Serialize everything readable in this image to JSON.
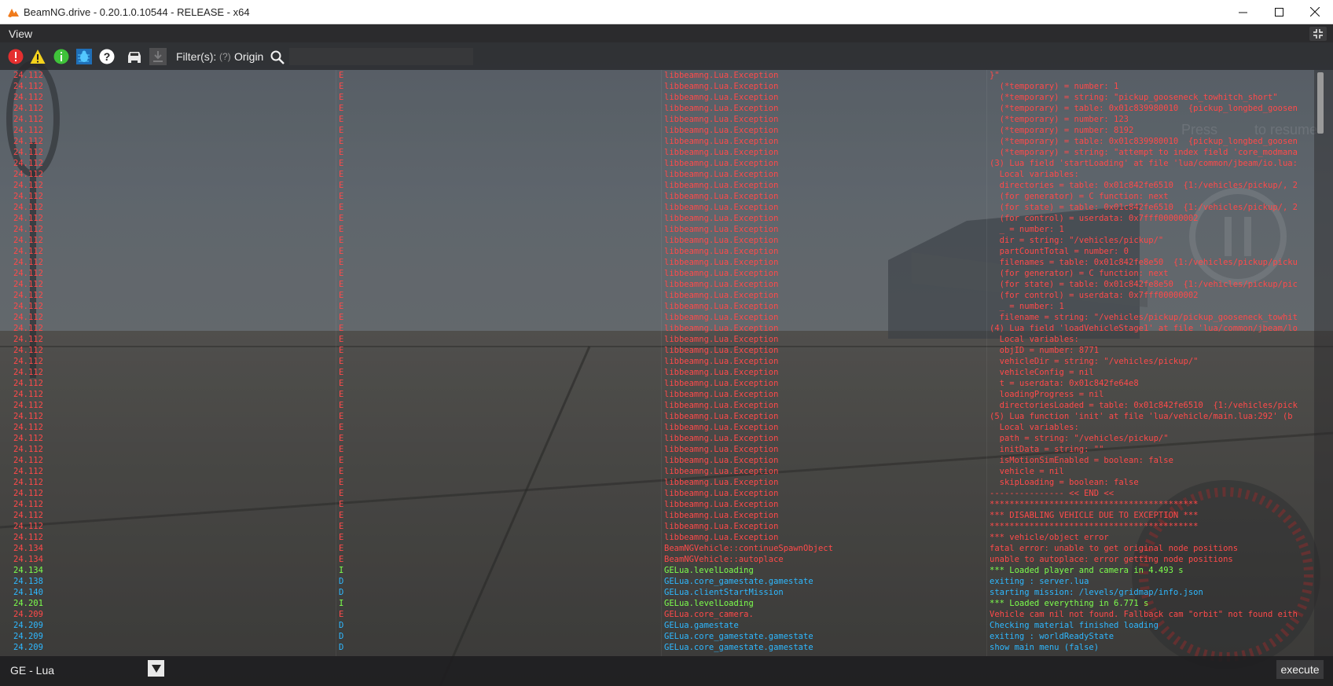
{
  "window": {
    "title": "BeamNG.drive - 0.20.1.0.10544 - RELEASE - x64"
  },
  "menu": {
    "view_label": "View"
  },
  "toolbar": {
    "filter_label": "Filter(s):",
    "filter_hint": "(?)",
    "origin_label": "Origin",
    "search_value": "",
    "icons": [
      "error-icon",
      "warning-icon",
      "info-icon",
      "debug-bug-icon",
      "help-icon",
      "vehicle-icon",
      "download-icon"
    ]
  },
  "colors": {
    "error": "#ff4a4a",
    "info": "#7dff4d",
    "debug": "#2eb8ff"
  },
  "hud": {
    "press_text": "Press",
    "resume_text": "to resume"
  },
  "log": {
    "rows": [
      {
        "time": "24.112",
        "level": "E",
        "origin": "libbeamng.Lua.Exception",
        "message": "}\""
      },
      {
        "time": "24.112",
        "level": "E",
        "origin": "libbeamng.Lua.Exception",
        "message": "  (*temporary) = number: 1"
      },
      {
        "time": "24.112",
        "level": "E",
        "origin": "libbeamng.Lua.Exception",
        "message": "  (*temporary) = string: \"pickup_gooseneck_towhitch_short\""
      },
      {
        "time": "24.112",
        "level": "E",
        "origin": "libbeamng.Lua.Exception",
        "message": "  (*temporary) = table: 0x01c839980010  {pickup_longbed_goosen"
      },
      {
        "time": "24.112",
        "level": "E",
        "origin": "libbeamng.Lua.Exception",
        "message": "  (*temporary) = number: 123"
      },
      {
        "time": "24.112",
        "level": "E",
        "origin": "libbeamng.Lua.Exception",
        "message": "  (*temporary) = number: 8192"
      },
      {
        "time": "24.112",
        "level": "E",
        "origin": "libbeamng.Lua.Exception",
        "message": "  (*temporary) = table: 0x01c839980010  {pickup_longbed_goosen"
      },
      {
        "time": "24.112",
        "level": "E",
        "origin": "libbeamng.Lua.Exception",
        "message": "  (*temporary) = string: \"attempt to index field 'core_modmana"
      },
      {
        "time": "24.112",
        "level": "E",
        "origin": "libbeamng.Lua.Exception",
        "message": "(3) Lua field 'startLoading' at file 'lua/common/jbeam/io.lua:"
      },
      {
        "time": "24.112",
        "level": "E",
        "origin": "libbeamng.Lua.Exception",
        "message": "  Local variables:"
      },
      {
        "time": "24.112",
        "level": "E",
        "origin": "libbeamng.Lua.Exception",
        "message": "  directories = table: 0x01c842fe6510  {1:/vehicles/pickup/, 2"
      },
      {
        "time": "24.112",
        "level": "E",
        "origin": "libbeamng.Lua.Exception",
        "message": "  (for generator) = C function: next"
      },
      {
        "time": "24.112",
        "level": "E",
        "origin": "libbeamng.Lua.Exception",
        "message": "  (for state) = table: 0x01c842fe6510  {1:/vehicles/pickup/, 2"
      },
      {
        "time": "24.112",
        "level": "E",
        "origin": "libbeamng.Lua.Exception",
        "message": "  (for control) = userdata: 0x7fff00000002"
      },
      {
        "time": "24.112",
        "level": "E",
        "origin": "libbeamng.Lua.Exception",
        "message": "  _ = number: 1"
      },
      {
        "time": "24.112",
        "level": "E",
        "origin": "libbeamng.Lua.Exception",
        "message": "  dir = string: \"/vehicles/pickup/\""
      },
      {
        "time": "24.112",
        "level": "E",
        "origin": "libbeamng.Lua.Exception",
        "message": "  partCountTotal = number: 0"
      },
      {
        "time": "24.112",
        "level": "E",
        "origin": "libbeamng.Lua.Exception",
        "message": "  filenames = table: 0x01c842fe8e50  {1:/vehicles/pickup/picku"
      },
      {
        "time": "24.112",
        "level": "E",
        "origin": "libbeamng.Lua.Exception",
        "message": "  (for generator) = C function: next"
      },
      {
        "time": "24.112",
        "level": "E",
        "origin": "libbeamng.Lua.Exception",
        "message": "  (for state) = table: 0x01c842fe8e50  {1:/vehicles/pickup/pic"
      },
      {
        "time": "24.112",
        "level": "E",
        "origin": "libbeamng.Lua.Exception",
        "message": "  (for control) = userdata: 0x7fff00000002"
      },
      {
        "time": "24.112",
        "level": "E",
        "origin": "libbeamng.Lua.Exception",
        "message": "  _ = number: 1"
      },
      {
        "time": "24.112",
        "level": "E",
        "origin": "libbeamng.Lua.Exception",
        "message": "  filename = string: \"/vehicles/pickup/pickup_gooseneck_towhit"
      },
      {
        "time": "24.112",
        "level": "E",
        "origin": "libbeamng.Lua.Exception",
        "message": "(4) Lua field 'loadVehicleStage1' at file 'lua/common/jbeam/lo"
      },
      {
        "time": "24.112",
        "level": "E",
        "origin": "libbeamng.Lua.Exception",
        "message": "  Local variables:"
      },
      {
        "time": "24.112",
        "level": "E",
        "origin": "libbeamng.Lua.Exception",
        "message": "  objID = number: 8771"
      },
      {
        "time": "24.112",
        "level": "E",
        "origin": "libbeamng.Lua.Exception",
        "message": "  vehicleDir = string: \"/vehicles/pickup/\""
      },
      {
        "time": "24.112",
        "level": "E",
        "origin": "libbeamng.Lua.Exception",
        "message": "  vehicleConfig = nil"
      },
      {
        "time": "24.112",
        "level": "E",
        "origin": "libbeamng.Lua.Exception",
        "message": "  t = userdata: 0x01c842fe64e8"
      },
      {
        "time": "24.112",
        "level": "E",
        "origin": "libbeamng.Lua.Exception",
        "message": "  loadingProgress = nil"
      },
      {
        "time": "24.112",
        "level": "E",
        "origin": "libbeamng.Lua.Exception",
        "message": "  directoriesLoaded = table: 0x01c842fe6510  {1:/vehicles/pick"
      },
      {
        "time": "24.112",
        "level": "E",
        "origin": "libbeamng.Lua.Exception",
        "message": "(5) Lua function 'init' at file 'lua/vehicle/main.lua:292' (b"
      },
      {
        "time": "24.112",
        "level": "E",
        "origin": "libbeamng.Lua.Exception",
        "message": "  Local variables:"
      },
      {
        "time": "24.112",
        "level": "E",
        "origin": "libbeamng.Lua.Exception",
        "message": "  path = string: \"/vehicles/pickup/\""
      },
      {
        "time": "24.112",
        "level": "E",
        "origin": "libbeamng.Lua.Exception",
        "message": "  initData = string: \"\""
      },
      {
        "time": "24.112",
        "level": "E",
        "origin": "libbeamng.Lua.Exception",
        "message": "  isMotionSimEnabled = boolean: false"
      },
      {
        "time": "24.112",
        "level": "E",
        "origin": "libbeamng.Lua.Exception",
        "message": "  vehicle = nil"
      },
      {
        "time": "24.112",
        "level": "E",
        "origin": "libbeamng.Lua.Exception",
        "message": "  skipLoading = boolean: false"
      },
      {
        "time": "24.112",
        "level": "E",
        "origin": "libbeamng.Lua.Exception",
        "message": "--------------- << END <<"
      },
      {
        "time": "24.112",
        "level": "E",
        "origin": "libbeamng.Lua.Exception",
        "message": "******************************************"
      },
      {
        "time": "24.112",
        "level": "E",
        "origin": "libbeamng.Lua.Exception",
        "message": "*** DISABLING VEHICLE DUE TO EXCEPTION ***"
      },
      {
        "time": "24.112",
        "level": "E",
        "origin": "libbeamng.Lua.Exception",
        "message": "******************************************"
      },
      {
        "time": "24.112",
        "level": "E",
        "origin": "libbeamng.Lua.Exception",
        "message": "*** vehicle/object error"
      },
      {
        "time": "24.134",
        "level": "E",
        "origin": "BeamNGVehicle::continueSpawnObject",
        "message": "fatal error: unable to get original node positions"
      },
      {
        "time": "24.134",
        "level": "E",
        "origin": "BeamNGVehicle::autoplace",
        "message": "unable to autoplace: error getting node positions"
      },
      {
        "time": "24.134",
        "level": "I",
        "origin": "GELua.levelLoading",
        "message": "*** Loaded player and camera in 4.493 s"
      },
      {
        "time": "24.138",
        "level": "D",
        "origin": "GELua.core_gamestate.gamestate",
        "message": "exiting : server.lua"
      },
      {
        "time": "24.140",
        "level": "D",
        "origin": "GELua.clientStartMission",
        "message": "starting mission: /levels/gridmap/info.json"
      },
      {
        "time": "24.201",
        "level": "I",
        "origin": "GELua.levelLoading",
        "message": "*** Loaded everything in 6.771 s"
      },
      {
        "time": "24.209",
        "level": "E",
        "origin": "GELua.core_camera.",
        "message": "Vehicle cam nil not found. Fallback cam \"orbit\" not found eith"
      },
      {
        "time": "24.209",
        "level": "D",
        "origin": "GELua.gamestate",
        "message": "Checking material finished loading"
      },
      {
        "time": "24.209",
        "level": "D",
        "origin": "GELua.core_gamestate.gamestate",
        "message": "exiting : worldReadyState"
      },
      {
        "time": "24.209",
        "level": "D",
        "origin": "GELua.core_gamestate.gamestate",
        "message": "show main menu (false)"
      }
    ]
  },
  "bottom": {
    "context_label": "GE - Lua",
    "command_value": "",
    "execute_label": "execute"
  }
}
